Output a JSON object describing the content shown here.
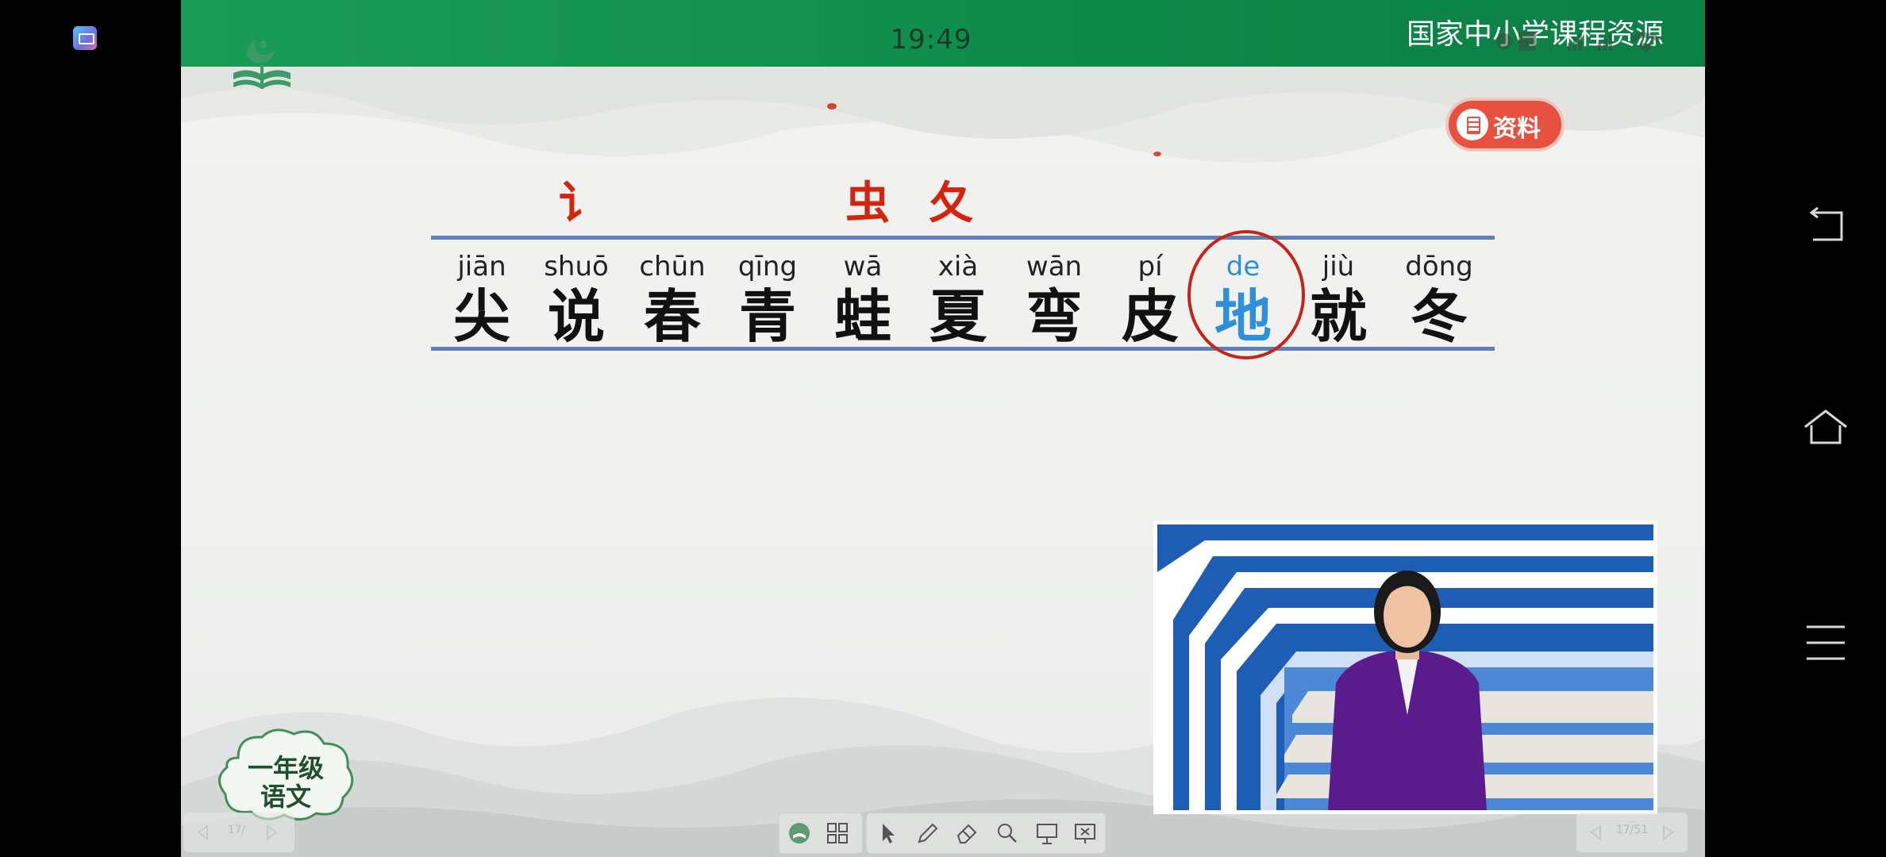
{
  "status_bar": {
    "time": "19:49"
  },
  "header": {
    "site_title": "国家中小学课程资源"
  },
  "resource_button": {
    "label": "资料"
  },
  "radicals": [
    {
      "char": "讠"
    },
    {
      "char": "虫"
    },
    {
      "char": "夂"
    }
  ],
  "characters": [
    {
      "pinyin": "jiān",
      "hanzi": "尖"
    },
    {
      "pinyin": "shuō",
      "hanzi": "说"
    },
    {
      "pinyin": "chūn",
      "hanzi": "春"
    },
    {
      "pinyin": "qīng",
      "hanzi": "青"
    },
    {
      "pinyin": "wā",
      "hanzi": "蛙"
    },
    {
      "pinyin": "xià",
      "hanzi": "夏"
    },
    {
      "pinyin": "wān",
      "hanzi": "弯"
    },
    {
      "pinyin": "pí",
      "hanzi": "皮"
    },
    {
      "pinyin": "de",
      "hanzi": "地"
    },
    {
      "pinyin": "jiù",
      "hanzi": "就"
    },
    {
      "pinyin": "dōng",
      "hanzi": "冬"
    }
  ],
  "highlighted_character": "地",
  "grade_badge": {
    "line1": "一年级",
    "line2": "语文"
  },
  "pager": {
    "left": "17/",
    "right": "17/51"
  },
  "toolbar": {
    "icons": [
      "resource-icon",
      "grid-icon",
      "pointer-icon",
      "pen-icon",
      "eraser-icon",
      "magnifier-icon",
      "whiteboard-icon",
      "screen-icon"
    ]
  },
  "colors": {
    "banner_green": "#0d8a4a",
    "radical_red": "#d4230f",
    "highlight_blue": "#2f8fd8",
    "line_blue": "#5f7fb8",
    "circle_red": "#c8231a",
    "button_red": "#e8503f"
  },
  "nav": {
    "icons": [
      "back-icon",
      "home-icon",
      "menu-icon"
    ]
  }
}
